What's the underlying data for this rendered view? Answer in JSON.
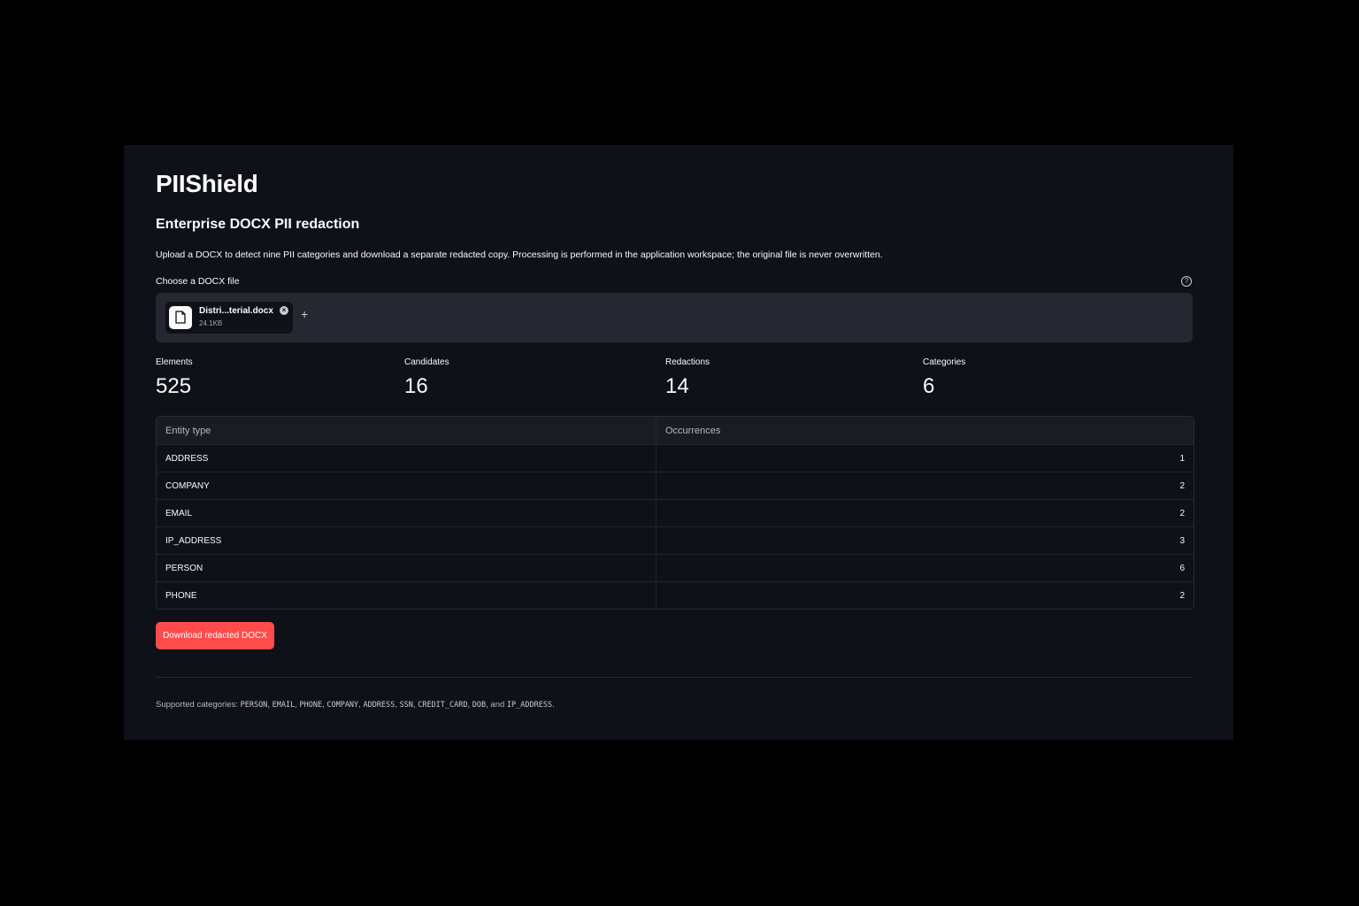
{
  "app": {
    "title": "PIIShield",
    "subtitle": "Enterprise DOCX PII redaction",
    "description": "Upload a DOCX to detect nine PII categories and download a separate redacted copy. Processing is performed in the application workspace; the original file is never overwritten."
  },
  "uploader": {
    "label": "Choose a DOCX file",
    "help_icon": "question-circle-icon",
    "file": {
      "name": "Distri...terial.docx",
      "size": "24.1KB",
      "icon": "file-icon"
    },
    "remove_icon": "close-icon",
    "add_icon": "plus-icon"
  },
  "metrics": [
    {
      "label": "Elements",
      "value": "525"
    },
    {
      "label": "Candidates",
      "value": "16"
    },
    {
      "label": "Redactions",
      "value": "14"
    },
    {
      "label": "Categories",
      "value": "6"
    }
  ],
  "table": {
    "headers": [
      "Entity type",
      "Occurrences"
    ],
    "rows": [
      {
        "type": "ADDRESS",
        "count": "1"
      },
      {
        "type": "COMPANY",
        "count": "2"
      },
      {
        "type": "EMAIL",
        "count": "2"
      },
      {
        "type": "IP_ADDRESS",
        "count": "3"
      },
      {
        "type": "PERSON",
        "count": "6"
      },
      {
        "type": "PHONE",
        "count": "2"
      }
    ]
  },
  "download_button": {
    "label": "Download redacted DOCX",
    "color": "#ff4b4b"
  },
  "footer": {
    "prefix": "Supported categories: ",
    "categories": [
      "PERSON",
      "EMAIL",
      "PHONE",
      "COMPANY",
      "ADDRESS",
      "SSN",
      "CREDIT_CARD",
      "DOB"
    ],
    "and_text": ", and ",
    "last_category": "IP_ADDRESS",
    "suffix": "."
  }
}
